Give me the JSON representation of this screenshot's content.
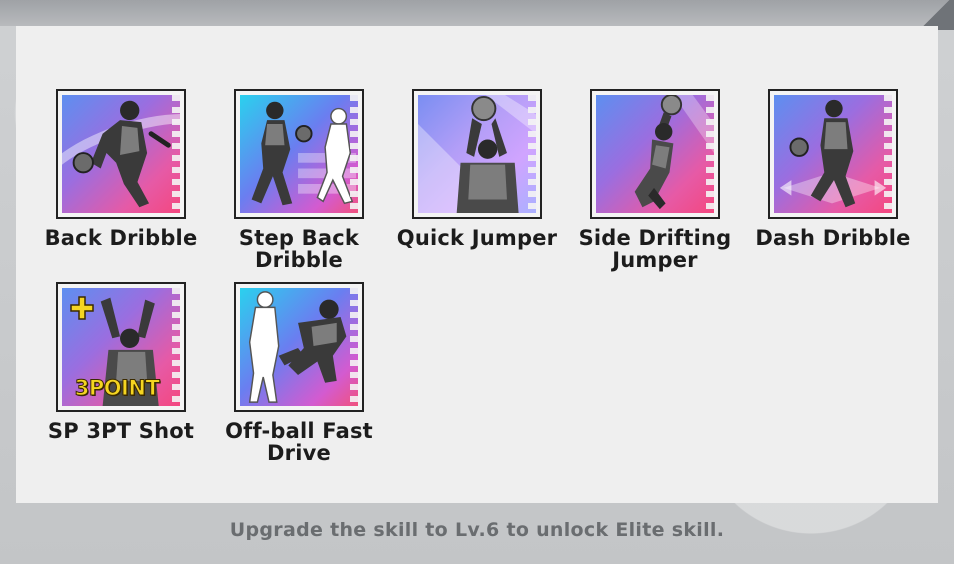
{
  "skills": [
    {
      "name": "Back Dribble",
      "lines": [
        "Back Dribble"
      ]
    },
    {
      "name": "Step Back Dribble",
      "lines": [
        "Step Back",
        "Dribble"
      ]
    },
    {
      "name": "Quick Jumper",
      "lines": [
        "Quick Jumper"
      ]
    },
    {
      "name": "Side Drifting Jumper",
      "lines": [
        "Side Drifting",
        "Jumper"
      ]
    },
    {
      "name": "Dash Dribble",
      "lines": [
        "Dash Dribble"
      ]
    },
    {
      "name": "SP 3PT Shot",
      "lines": [
        "SP 3PT Shot"
      ],
      "badge": "3POINT",
      "plus_icon": "plus-icon"
    },
    {
      "name": "Off-ball Fast Drive",
      "lines": [
        "Off-ball Fast",
        "Drive"
      ]
    }
  ],
  "footer": {
    "hint": "Upgrade the skill to Lv.6 to unlock Elite skill."
  },
  "colors": {
    "panel": "#efefef",
    "frame": "#c9cbcd",
    "label": "#1c1c1c",
    "footer": "#6a6d70",
    "badge": "#f5d521"
  }
}
